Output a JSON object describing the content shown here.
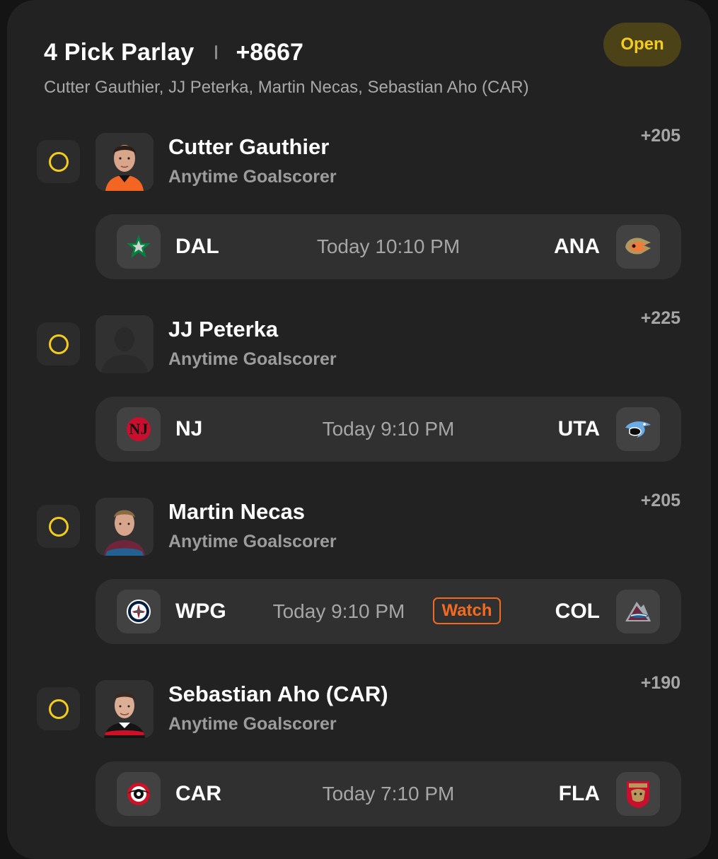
{
  "header": {
    "title": "4 Pick Parlay",
    "total_odds": "+8667",
    "subtitle": "Cutter Gauthier, JJ Peterka, Martin Necas, Sebastian Aho (CAR)",
    "status": "Open"
  },
  "picks": [
    {
      "player": "Cutter Gauthier",
      "market": "Anytime Goalscorer",
      "odds": "+205",
      "headshot": "player-headshot",
      "game": {
        "away": "DAL",
        "time": "Today 10:10 PM",
        "home": "ANA",
        "away_logo": "stars-logo",
        "home_logo": "ducks-logo"
      }
    },
    {
      "player": "JJ Peterka",
      "market": "Anytime Goalscorer",
      "odds": "+225",
      "headshot": "placeholder-silhouette",
      "game": {
        "away": "NJ",
        "time": "Today 9:10 PM",
        "home": "UTA",
        "away_logo": "devils-logo",
        "home_logo": "utah-logo"
      }
    },
    {
      "player": "Martin Necas",
      "market": "Anytime Goalscorer",
      "odds": "+205",
      "headshot": "player-headshot",
      "game": {
        "away": "WPG",
        "time": "Today 9:10 PM",
        "watch": "Watch",
        "home": "COL",
        "away_logo": "jets-logo",
        "home_logo": "avalanche-logo"
      }
    },
    {
      "player": "Sebastian Aho (CAR)",
      "market": "Anytime Goalscorer",
      "odds": "+190",
      "headshot": "player-headshot",
      "game": {
        "away": "CAR",
        "time": "Today 7:10 PM",
        "home": "FLA",
        "away_logo": "hurricanes-logo",
        "home_logo": "panthers-logo"
      }
    }
  ],
  "colors": {
    "accent": "#f4cc1d",
    "status_bg": "#4b4218",
    "watch": "#f26b21",
    "card_bg": "#222222",
    "game_bg": "#303030"
  }
}
